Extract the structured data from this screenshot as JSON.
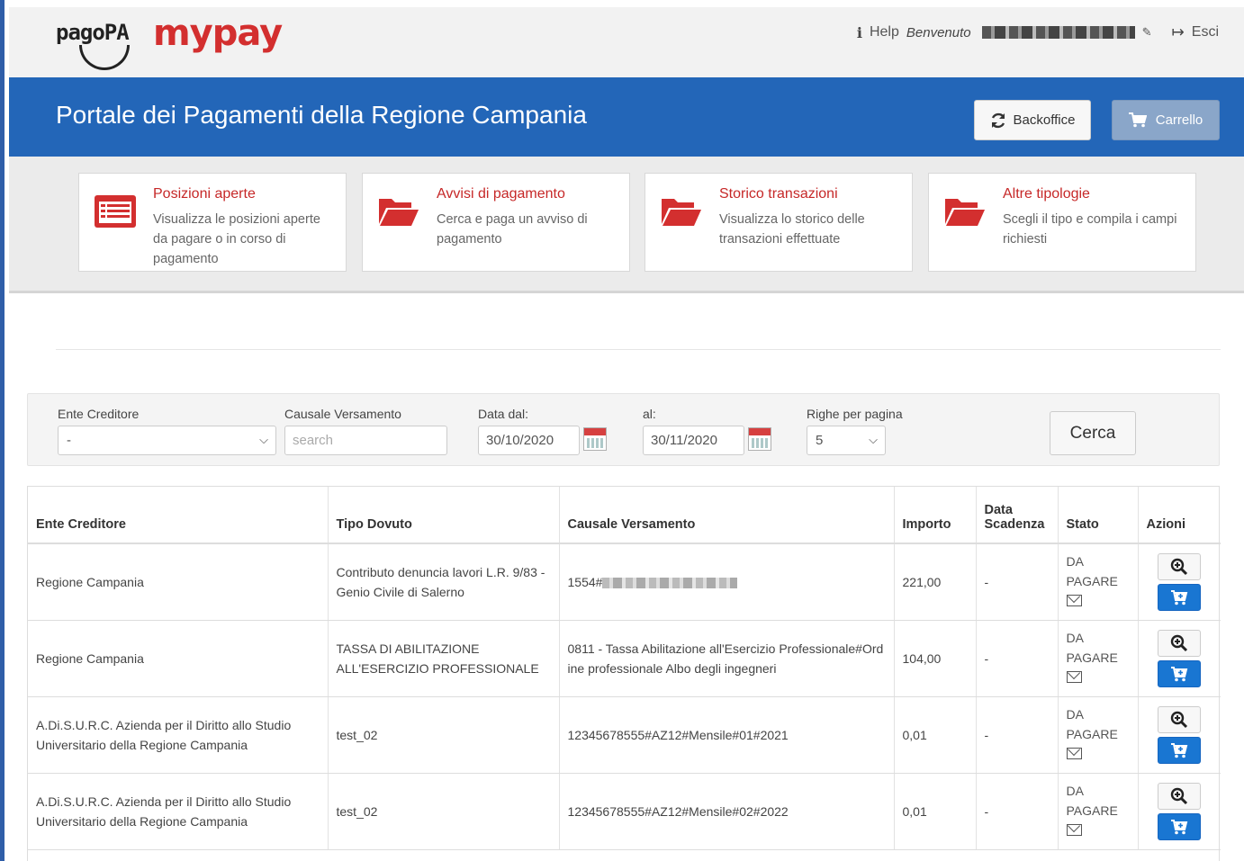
{
  "topbar": {
    "logo_pagopa": "pagoPA",
    "logo_mypay": "mypay",
    "help_label": "Help",
    "welcome_label": "Benvenuto",
    "exit_label": "Esci"
  },
  "header": {
    "title": "Portale dei Pagamenti della Regione Campania",
    "backoffice_label": "Backoffice",
    "cart_label": "Carrello"
  },
  "nav_cards": [
    {
      "title": "Posizioni aperte",
      "desc": "Visualizza le posizioni aperte da pagare o in corso di pagamento",
      "icon": "list-icon"
    },
    {
      "title": "Avvisi di pagamento",
      "desc": "Cerca e paga un avviso di pagamento",
      "icon": "folder-open-icon"
    },
    {
      "title": "Storico transazioni",
      "desc": "Visualizza lo storico delle transazioni effettuate",
      "icon": "folder-open-icon"
    },
    {
      "title": "Altre tipologie",
      "desc": "Scegli il tipo e compila i campi richiesti",
      "icon": "folder-open-icon"
    }
  ],
  "filters": {
    "ente_label": "Ente Creditore",
    "ente_value": "-",
    "causale_label": "Causale Versamento",
    "causale_placeholder": "search",
    "data_dal_label": "Data dal:",
    "data_dal_value": "30/10/2020",
    "al_label": "al:",
    "al_value": "30/11/2020",
    "righe_label": "Righe per pagina",
    "righe_value": "5",
    "search_button": "Cerca"
  },
  "table": {
    "headers": [
      "Ente Creditore",
      "Tipo Dovuto",
      "Causale Versamento",
      "Importo",
      "Data Scadenza",
      "Stato",
      "Azioni"
    ],
    "rows": [
      {
        "ente": "Regione Campania",
        "tipo": "Contributo denuncia lavori L.R. 9/83 - Genio Civile di Salerno",
        "causale": "1554#",
        "causale_redacted": true,
        "importo": "221,00",
        "scadenza": "-",
        "stato": "DA PAGARE"
      },
      {
        "ente": "Regione Campania",
        "tipo": "TASSA DI ABILITAZIONE ALL'ESERCIZIO PROFESSIONALE",
        "causale": "0811 - Tassa Abilitazione all'Esercizio Professionale#Ordine professionale Albo degli ingegneri",
        "causale_redacted": false,
        "importo": "104,00",
        "scadenza": "-",
        "stato": "DA PAGARE"
      },
      {
        "ente": "A.Di.S.U.R.C. Azienda per il Diritto allo Studio Universitario della Regione Campania",
        "tipo": "test_02",
        "causale": "12345678555#AZ12#Mensile#01#2021",
        "causale_redacted": false,
        "importo": "0,01",
        "scadenza": "-",
        "stato": "DA PAGARE"
      },
      {
        "ente": "A.Di.S.U.R.C. Azienda per il Diritto allo Studio Universitario della Regione Campania",
        "tipo": "test_02",
        "causale": "12345678555#AZ12#Mensile#02#2022",
        "causale_redacted": false,
        "importo": "0,01",
        "scadenza": "-",
        "stato": "DA PAGARE"
      }
    ]
  },
  "colors": {
    "header_blue": "#2366b8",
    "brand_red": "#c62828",
    "pay_blue": "#1976d2"
  }
}
